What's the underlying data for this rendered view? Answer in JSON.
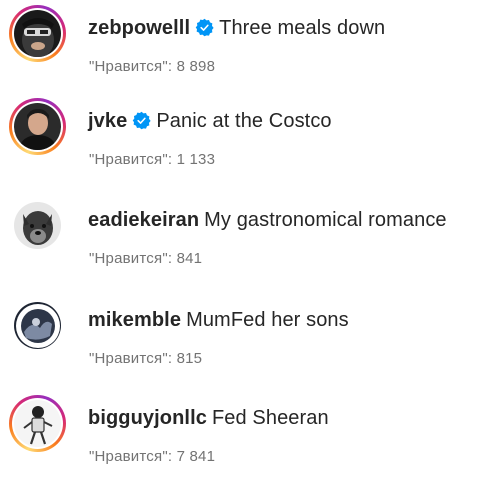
{
  "comments": [
    {
      "username": "zebpowelll",
      "verified": true,
      "text": "Three meals down",
      "likes": "\"Нравится\": 8 898"
    },
    {
      "username": "jvke",
      "verified": true,
      "text": "Panic at the Costco",
      "likes": "\"Нравится\": 1 133"
    },
    {
      "username": "eadiekeiran",
      "verified": false,
      "text": "My gastronomical romance",
      "likes": "\"Нравится\": 841"
    },
    {
      "username": "mikemble",
      "verified": false,
      "text": "MumFed her sons",
      "likes": "\"Нравится\": 815"
    },
    {
      "username": "bigguyjonllc",
      "verified": false,
      "text": "Fed Sheeran",
      "likes": "\"Нравится\": 7 841"
    }
  ],
  "colors": {
    "verified_badge": "#0095f6",
    "secondary_text": "#737373",
    "primary_text": "#262626"
  }
}
